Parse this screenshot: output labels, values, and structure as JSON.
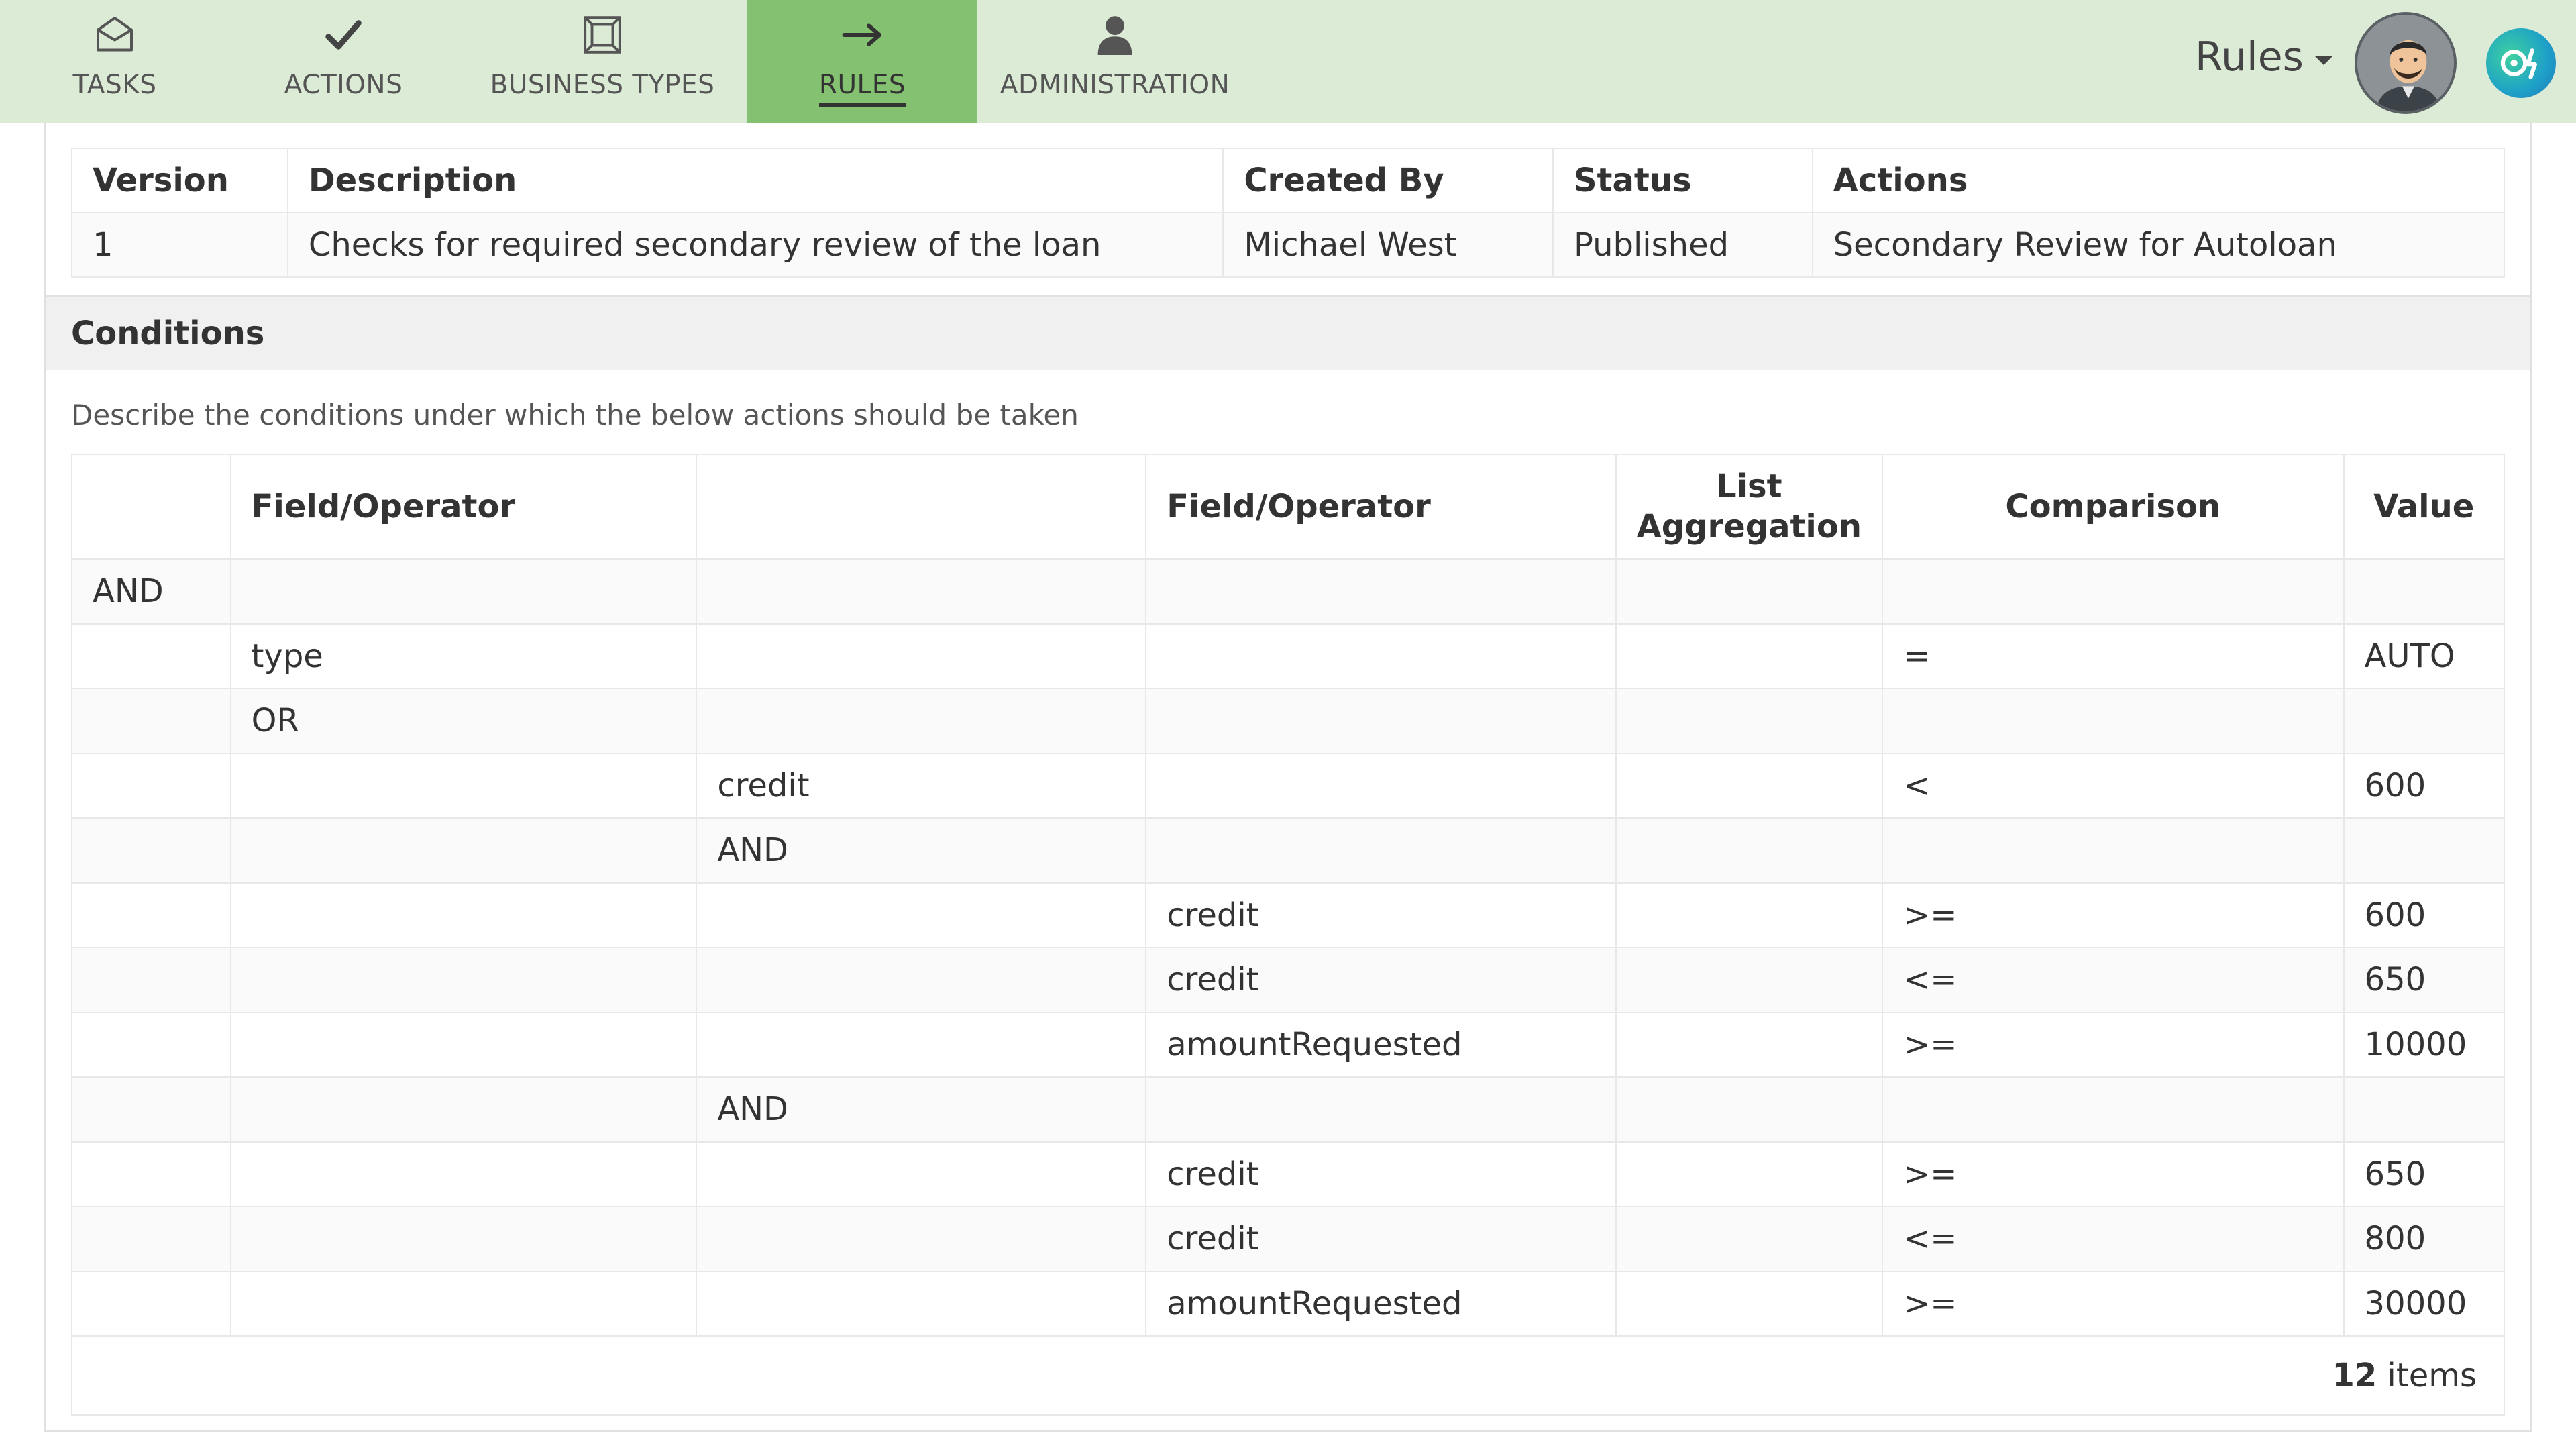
{
  "nav": {
    "items": [
      {
        "label": "TASKS",
        "icon": "inbox-icon"
      },
      {
        "label": "ACTIONS",
        "icon": "checkmark-icon"
      },
      {
        "label": "BUSINESS TYPES",
        "icon": "frame-icon"
      },
      {
        "label": "RULES",
        "icon": "arrow-right-icon",
        "active": true
      },
      {
        "label": "ADMINISTRATION",
        "icon": "user-icon"
      }
    ],
    "rules_dropdown": "Rules"
  },
  "colors": {
    "topbar_bg": "#dcebd6",
    "active_tab_bg": "#84c271"
  },
  "version_table": {
    "headers": [
      "Version",
      "Description",
      "Created By",
      "Status",
      "Actions"
    ],
    "row": [
      "1",
      "Checks for required secondary review of the loan",
      "Michael West",
      "Published",
      "Secondary Review for Autoloan"
    ]
  },
  "conditions": {
    "title": "Conditions",
    "description": "Describe the conditions under which the below actions should be taken",
    "headers": [
      "",
      "Field/Operator",
      "",
      "Field/Operator",
      "List Aggregation",
      "Comparison",
      "Value"
    ],
    "rows": [
      [
        "AND",
        "",
        "",
        "",
        "",
        "",
        ""
      ],
      [
        "",
        "type",
        "",
        "",
        "",
        "=",
        "AUTO"
      ],
      [
        "",
        "OR",
        "",
        "",
        "",
        "",
        ""
      ],
      [
        "",
        "",
        "credit",
        "",
        "",
        "<",
        "600"
      ],
      [
        "",
        "",
        "AND",
        "",
        "",
        "",
        ""
      ],
      [
        "",
        "",
        "",
        "credit",
        "",
        ">=",
        "600"
      ],
      [
        "",
        "",
        "",
        "credit",
        "",
        "<=",
        "650"
      ],
      [
        "",
        "",
        "",
        "amountRequested",
        "",
        ">=",
        "10000"
      ],
      [
        "",
        "",
        "AND",
        "",
        "",
        "",
        ""
      ],
      [
        "",
        "",
        "",
        "credit",
        "",
        ">=",
        "650"
      ],
      [
        "",
        "",
        "",
        "credit",
        "",
        "<=",
        "800"
      ],
      [
        "",
        "",
        "",
        "amountRequested",
        "",
        ">=",
        "30000"
      ]
    ],
    "footer": {
      "count": "12",
      "unit": "items"
    }
  }
}
